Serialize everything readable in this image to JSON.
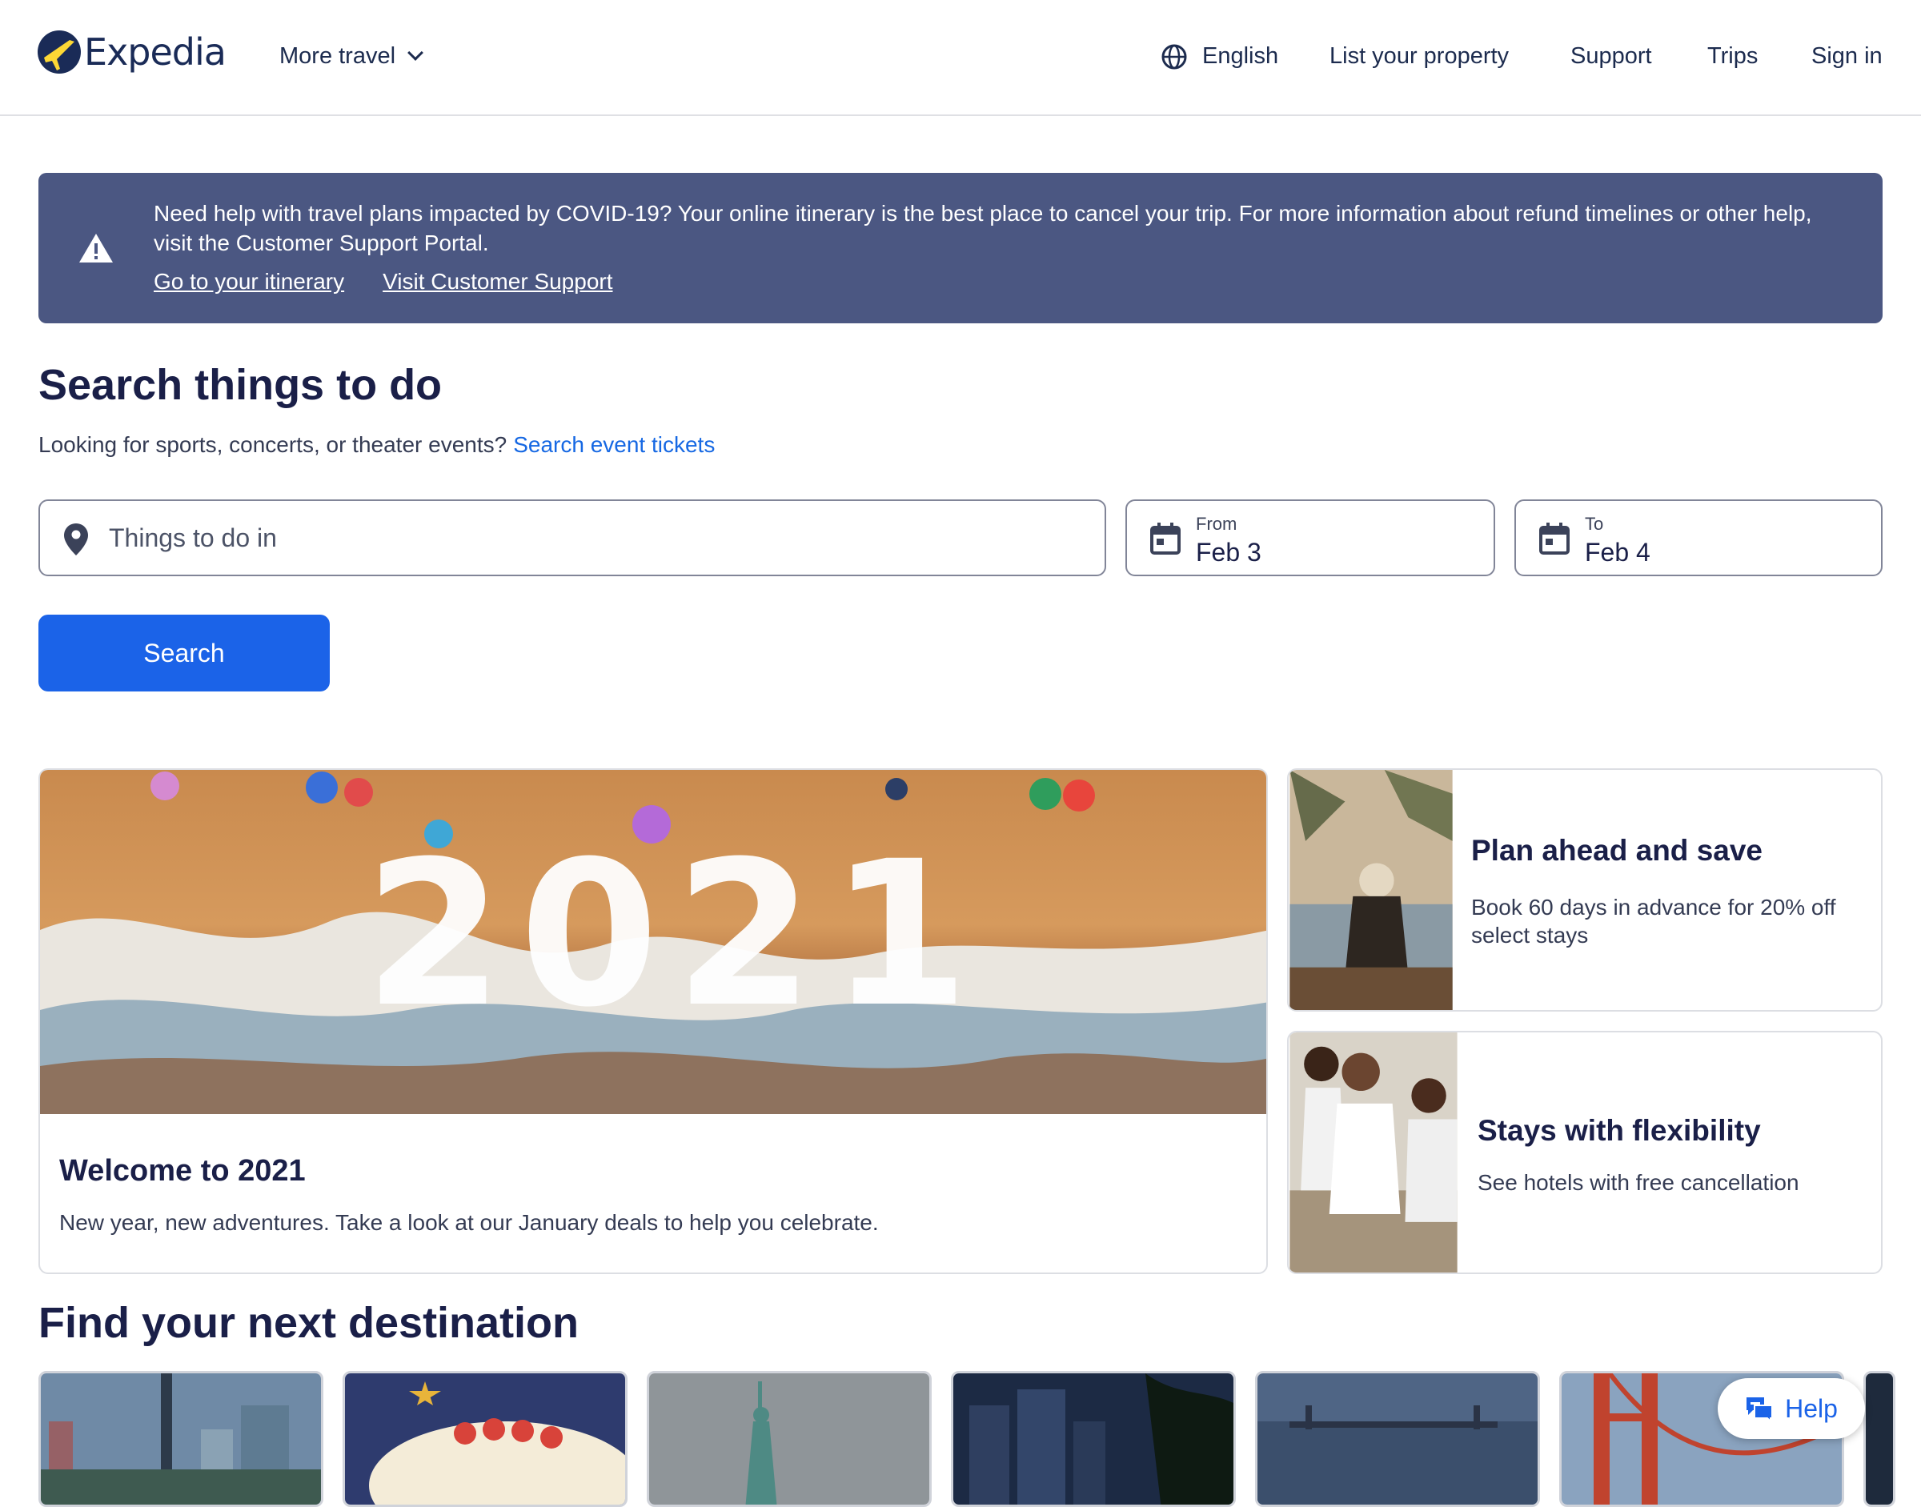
{
  "header": {
    "brand": "Expedia",
    "more_travel": "More travel",
    "language": "English",
    "list_property": "List your property",
    "support": "Support",
    "trips": "Trips",
    "sign_in": "Sign in"
  },
  "banner": {
    "message": "Need help with travel plans impacted by COVID-19? Your online itinerary is the best place to cancel your trip. For more information about refund timelines or other help, visit the Customer Support Portal.",
    "link_itinerary": "Go to your itinerary",
    "link_support": "Visit Customer Support"
  },
  "search": {
    "title": "Search things to do",
    "subtitle": "Looking for sports, concerts, or theater events?",
    "subtitle_link": "Search event tickets",
    "location_placeholder": "Things to do in",
    "from_label": "From",
    "from_value": "Feb 3",
    "to_label": "To",
    "to_value": "Feb 4",
    "button": "Search"
  },
  "promos": {
    "hero": {
      "image_text": "2021",
      "title": "Welcome to 2021",
      "desc": "New year, new adventures. Take a look at our January deals to help you celebrate."
    },
    "plan": {
      "title": "Plan ahead and save",
      "desc": "Book 60 days in advance for 20% off select stays"
    },
    "flex": {
      "title": "Stays with flexibility",
      "desc": "See hotels with free cancellation"
    }
  },
  "destinations": {
    "title": "Find your next destination"
  },
  "help": {
    "label": "Help"
  },
  "colors": {
    "primary": "#1b63e8",
    "banner": "#4b5782",
    "heading": "#1a1f48"
  }
}
